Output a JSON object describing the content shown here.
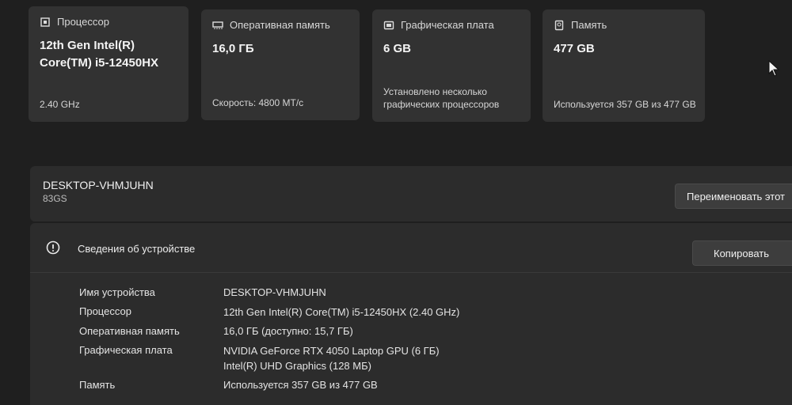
{
  "cards": [
    {
      "title": "Процессор",
      "value": "12th Gen Intel(R) Core(TM) i5-12450HX",
      "sub": "2.40 GHz",
      "icon": "cpu-icon"
    },
    {
      "title": "Оперативная память",
      "value": "16,0 ГБ",
      "sub": "Скорость: 4800 МТ/с",
      "icon": "ram-icon"
    },
    {
      "title": "Графическая плата",
      "value": "6 GB",
      "sub": "Установлено несколько графических процессоров",
      "icon": "gpu-icon"
    },
    {
      "title": "Память",
      "value": "477 GB",
      "sub": "Используется 357 GB из 477 GB",
      "icon": "storage-icon"
    }
  ],
  "device": {
    "name": "DESKTOP-VHMJUHN",
    "model": "83GS",
    "rename_label": "Переименовать этот"
  },
  "specs": {
    "title": "Сведения об устройстве",
    "copy_label": "Копировать",
    "rows": [
      {
        "label": "Имя устройства",
        "value": "DESKTOP-VHMJUHN"
      },
      {
        "label": "Процессор",
        "value": "12th Gen Intel(R) Core(TM) i5-12450HX (2.40 GHz)"
      },
      {
        "label": "Оперативная память",
        "value": "16,0 ГБ (доступно: 15,7 ГБ)"
      },
      {
        "label": "Графическая плата",
        "value": "NVIDIA GeForce RTX 4050 Laptop GPU (6 ГБ)",
        "value2": "Intel(R) UHD Graphics (128 МБ)"
      },
      {
        "label": "Память",
        "value": "Используется 357 GB из 477 GB"
      }
    ]
  }
}
